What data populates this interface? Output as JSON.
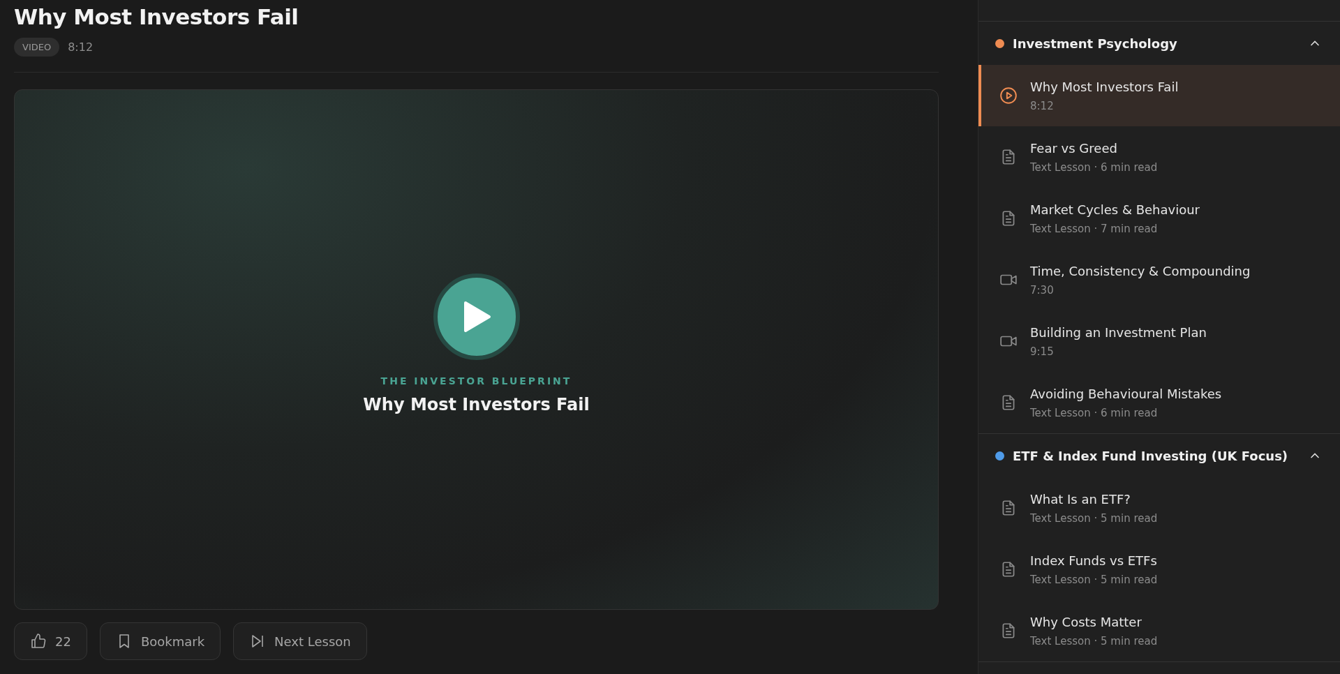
{
  "lesson": {
    "title": "Why Most Investors Fail",
    "badge": "VIDEO",
    "duration": "8:12"
  },
  "player": {
    "eyebrow": "THE INVESTOR BLUEPRINT",
    "title": "Why Most Investors Fail"
  },
  "actions": {
    "likes": "22",
    "bookmark": "Bookmark",
    "next": "Next Lesson"
  },
  "sidebar": {
    "sections": [
      {
        "title": "Investment Psychology",
        "color": "#ef8c52",
        "expanded": true,
        "items": [
          {
            "kind": "video",
            "title": "Why Most Investors Fail",
            "meta": "8:12",
            "selected": true
          },
          {
            "kind": "text",
            "title": "Fear vs Greed",
            "meta": "Text Lesson · 6 min read",
            "selected": false
          },
          {
            "kind": "text",
            "title": "Market Cycles & Behaviour",
            "meta": "Text Lesson · 7 min read",
            "selected": false
          },
          {
            "kind": "video",
            "title": "Time, Consistency & Compounding",
            "meta": "7:30",
            "selected": false
          },
          {
            "kind": "video",
            "title": "Building an Investment Plan",
            "meta": "9:15",
            "selected": false
          },
          {
            "kind": "text",
            "title": "Avoiding Behavioural Mistakes",
            "meta": "Text Lesson · 6 min read",
            "selected": false
          }
        ]
      },
      {
        "title": "ETF & Index Fund Investing (UK Focus)",
        "color": "#4f9be8",
        "expanded": true,
        "items": [
          {
            "kind": "text",
            "title": "What Is an ETF?",
            "meta": "Text Lesson · 5 min read",
            "selected": false
          },
          {
            "kind": "text",
            "title": "Index Funds vs ETFs",
            "meta": "Text Lesson · 5 min read",
            "selected": false
          },
          {
            "kind": "text",
            "title": "Why Costs Matter",
            "meta": "Text Lesson · 5 min read",
            "selected": false
          }
        ]
      }
    ]
  }
}
